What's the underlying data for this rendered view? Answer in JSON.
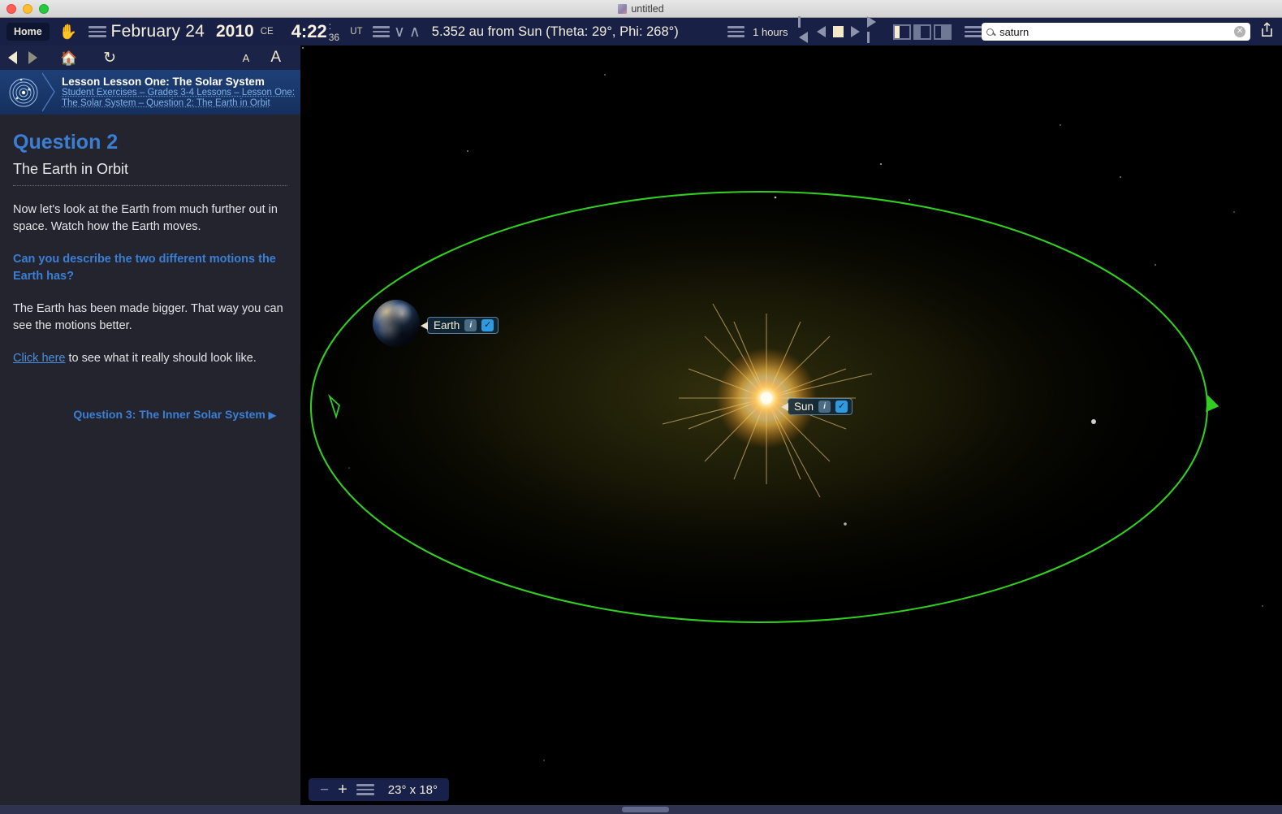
{
  "window": {
    "title": "untitled",
    "doc_icon": "document-icon"
  },
  "toolbar": {
    "home_label": "Home",
    "hand_icon": "hand-tool-icon",
    "date_menu_icon": "hamburger-icon",
    "date": "February 24",
    "year": "2010",
    "era": "CE",
    "time": "4:22",
    "seconds": ": 36",
    "timezone": "UT",
    "time_menu_icon": "hamburger-icon",
    "down_chevron": "∨",
    "up_chevron": "∧",
    "viewpoint": "5.352 au from Sun (Theta: 29°, Phi: 268°)",
    "view_menu_icon": "hamburger-icon",
    "rate_menu_icon": "hamburger-icon",
    "time_rate": "1  hours",
    "playback": {
      "skip_back": "skip-back-icon",
      "step_back": "step-back-icon",
      "stop": "stop-icon",
      "play": "play-icon",
      "skip_forward": "skip-forward-icon"
    },
    "layouts": [
      "layout-sidebar-left",
      "layout-split",
      "layout-sidebar-right"
    ],
    "options_menu_icon": "hamburger-icon",
    "search_value": "saturn",
    "search_placeholder": "Search",
    "search_icon": "search-icon",
    "clear_icon": "✕",
    "share_icon": "share-icon"
  },
  "sidebar": {
    "nav": {
      "back_icon": "back-arrow-icon",
      "forward_icon": "forward-arrow-icon",
      "home_icon": "home-icon",
      "refresh_icon": "refresh-icon",
      "font_small": "A",
      "font_large": "A"
    },
    "lesson_header": {
      "icon": "solar-system-icon",
      "title": "Lesson Lesson One: The Solar System",
      "breadcrumb_line1": "Student Exercises – Grades 3-4 Lessons – Lesson One:",
      "breadcrumb_line2": "The Solar System – Question 2: The Earth in Orbit"
    },
    "content": {
      "question_number": "Question 2",
      "question_title": "The Earth in Orbit",
      "paragraph1": "Now let's look at the Earth from much further out in space. Watch how the Earth moves.",
      "prompt": "Can you describe the two different motions the Earth has?",
      "paragraph2": "The Earth has been made bigger. That way you can see the motions better.",
      "link_text": "Click here",
      "link_suffix": " to see what it really should look like.",
      "next_question": "Question 3: The Inner Solar System",
      "next_arrow": "▶"
    }
  },
  "sky": {
    "orbit_color": "#33cc22",
    "objects": [
      {
        "name": "Earth",
        "info_icon": "i",
        "check_icon": "✓"
      },
      {
        "name": "Sun",
        "info_icon": "i",
        "check_icon": "✓"
      }
    ],
    "fov": {
      "zoom_out_icon": "−",
      "zoom_in_icon": "+",
      "fov_menu_icon": "hamburger-icon",
      "field_of_view": "23° x 18°"
    }
  }
}
